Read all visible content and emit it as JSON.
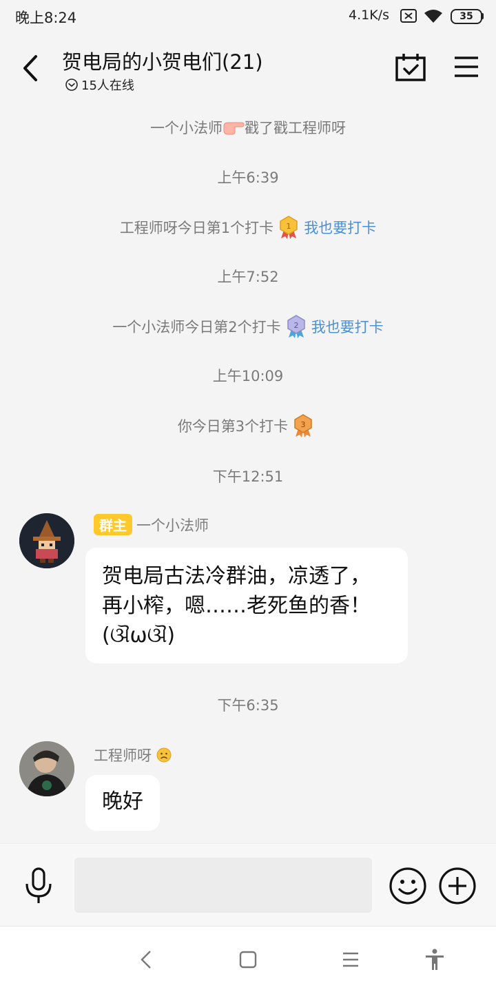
{
  "status_bar": {
    "time": "晚上8:24",
    "net_speed": "4.1K/s",
    "battery": "35",
    "icons": [
      "sim-none-icon",
      "wifi-icon",
      "battery-icon"
    ]
  },
  "header": {
    "title": "贺电局的小贺电们(21)",
    "online": "15人在线"
  },
  "system_messages": {
    "poke": {
      "actor": "一个小法师",
      "text": "戳了戳工程师呀"
    },
    "time1": "上午6:39",
    "checkin1": {
      "text": "工程师呀今日第1个打卡",
      "link": "我也要打卡"
    },
    "time2": "上午7:52",
    "checkin2": {
      "text": "一个小法师今日第2个打卡",
      "link": "我也要打卡"
    },
    "time3": "上午10:09",
    "checkin3": {
      "text": "你今日第3个打卡"
    },
    "time4": "下午12:51",
    "time5": "下午6:35"
  },
  "messages": [
    {
      "badge": "群主",
      "sender": "一个小法师",
      "lines": [
        "贺电局古法冷群油，凉透了，",
        "再小榨，嗯……老死鱼的香！",
        "(ଔωଔ)"
      ]
    },
    {
      "sender": "工程师呀",
      "lines": [
        "晚好"
      ]
    }
  ],
  "input": {
    "placeholder": ""
  },
  "colors": {
    "link": "#4a8fd8",
    "badge": "#ffc92c",
    "background": "#f4f4f4"
  }
}
